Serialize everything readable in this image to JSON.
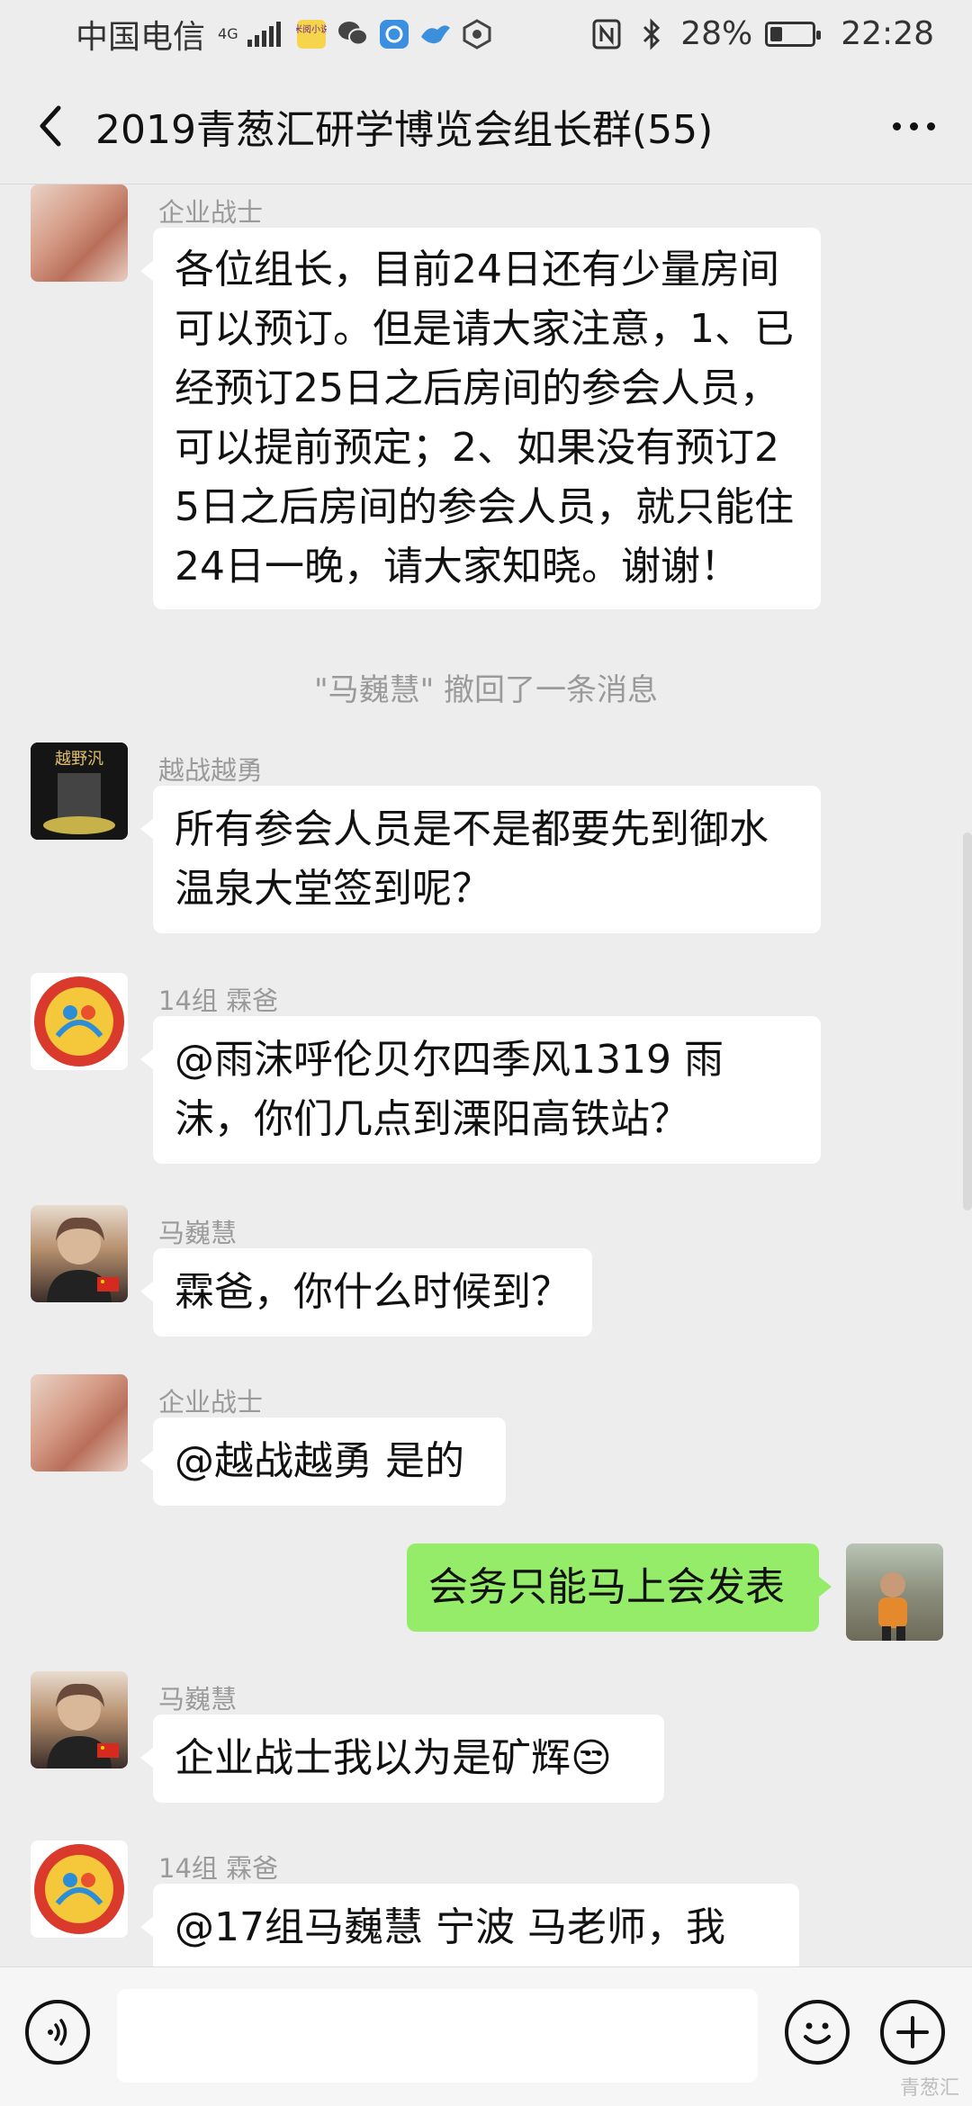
{
  "status_bar": {
    "carrier": "中国电信",
    "network": "4G",
    "app_badge_text": "米阅小说",
    "battery": "28%",
    "time": "22:28"
  },
  "header": {
    "title": "2019青葱汇研学博览会组长群(55)"
  },
  "messages": [
    {
      "sender": "企业战士",
      "text": "各位组长，目前24日还有少量房间可以预订。但是请大家注意，1、已经预订25日之后房间的参会人员，可以提前预定；2、如果没有预订25日之后房间的参会人员，就只能住24日一晚，请大家知晓。谢谢！"
    },
    {
      "system": "\"马巍慧\" 撤回了一条消息"
    },
    {
      "sender": "越战越勇",
      "text": "所有参会人员是不是都要先到御水温泉大堂签到呢？"
    },
    {
      "sender": "14组  霖爸",
      "text": "@雨沫呼伦贝尔四季风1319  雨沫，你们几点到溧阳高铁站？"
    },
    {
      "sender": "马巍慧",
      "text": "霖爸，你什么时候到？"
    },
    {
      "sender": "企业战士",
      "text": "@越战越勇  是的"
    },
    {
      "outgoing": true,
      "text": "会务只能马上会发表"
    },
    {
      "sender": "马巍慧",
      "text": "企业战士我以为是矿辉😒"
    },
    {
      "sender": "14组  霖爸",
      "text": "@17组马巍慧  宁波  马老师，我"
    }
  ],
  "avatar_texts": {
    "dark_avatar": "越野汎"
  },
  "watermark": "青葱汇",
  "colors": {
    "background": "#ededed",
    "outgoing_bubble": "#95ec69",
    "incoming_bubble": "#ffffff"
  }
}
